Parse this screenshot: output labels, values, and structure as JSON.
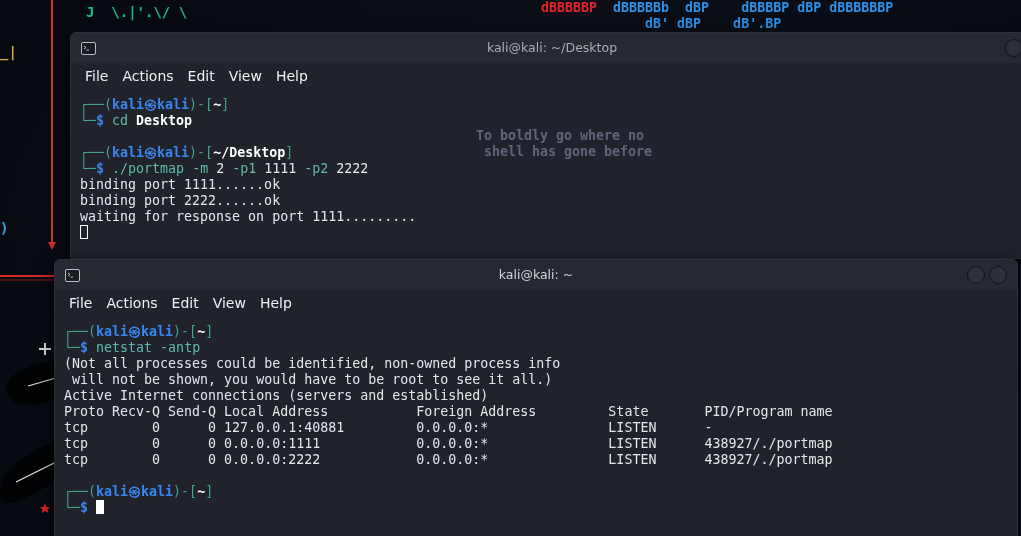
{
  "wallpaper": {
    "banner_lines": [
      [
        {
          "text": "dBBBBBP",
          "color": "#e5242b"
        },
        {
          "text": "  dBBBBBb  dBP    dBBBBP dBP dBBBBBBP",
          "color": "#2b90e6"
        }
      ],
      [
        {
          "text": "dB' dBP    dB'.BP",
          "color": "#2b90e6"
        }
      ]
    ],
    "art_fragments": [
      {
        "text": "J  \\.|'.\\/ \\",
        "color": "#18b894"
      },
      {
        "text": "_|",
        "color": "#d6a24a"
      },
      {
        "text": ")",
        "color": "#2aa8e0"
      }
    ],
    "motto": [
      "To boldly go where no",
      "shell has gone before"
    ]
  },
  "windows": [
    {
      "title": "kali@kali: ~/Desktop",
      "focused": false,
      "menu": [
        "File",
        "Actions",
        "Edit",
        "View",
        "Help"
      ],
      "lines": [
        {
          "kind": "prompt",
          "frame_top": "┌──(",
          "user": "kali",
          "at": "㉿",
          "host": "kali",
          "sep": ")-[",
          "cwd": "~",
          "close": "]",
          "frame_bottom": "└─",
          "symbol": "$",
          "tokens": [
            {
              "kind": "cmd",
              "text": "cd"
            },
            {
              "kind": "path",
              "text": "Desktop"
            }
          ]
        },
        {
          "kind": "blank"
        },
        {
          "kind": "prompt",
          "frame_top": "┌──(",
          "user": "kali",
          "at": "㉿",
          "host": "kali",
          "sep": ")-[",
          "cwd": "~/Desktop",
          "close": "]",
          "frame_bottom": "└─",
          "symbol": "$",
          "tokens": [
            {
              "kind": "cmd",
              "text": "./portmap"
            },
            {
              "kind": "opt",
              "text": "-m"
            },
            {
              "kind": "arg",
              "text": "2"
            },
            {
              "kind": "opt",
              "text": "-p1"
            },
            {
              "kind": "arg",
              "text": "1111"
            },
            {
              "kind": "opt",
              "text": "-p2"
            },
            {
              "kind": "arg",
              "text": "2222"
            }
          ]
        },
        {
          "kind": "output",
          "text": "binding port 1111......ok"
        },
        {
          "kind": "output",
          "text": "binding port 2222......ok"
        },
        {
          "kind": "output",
          "text": "waiting for response on port 1111........."
        },
        {
          "kind": "cursor"
        }
      ]
    },
    {
      "title": "kali@kali: ~",
      "focused": true,
      "menu": [
        "File",
        "Actions",
        "Edit",
        "View",
        "Help"
      ],
      "lines": [
        {
          "kind": "prompt",
          "frame_top": "┌──(",
          "user": "kali",
          "at": "㉿",
          "host": "kali",
          "sep": ")-[",
          "cwd": "~",
          "close": "]",
          "frame_bottom": "└─",
          "symbol": "$",
          "tokens": [
            {
              "kind": "cmd",
              "text": "netstat"
            },
            {
              "kind": "opt",
              "text": "-antp"
            }
          ]
        },
        {
          "kind": "output",
          "text": "(Not all processes could be identified, non-owned process info"
        },
        {
          "kind": "output",
          "text": " will not be shown, you would have to be root to see it all.)"
        },
        {
          "kind": "output",
          "text": "Active Internet connections (servers and established)"
        },
        {
          "kind": "output",
          "text": "Proto Recv-Q Send-Q Local Address           Foreign Address         State       PID/Program name"
        },
        {
          "kind": "output",
          "text": "tcp        0      0 127.0.0.1:40881         0.0.0.0:*               LISTEN      -"
        },
        {
          "kind": "output",
          "text": "tcp        0      0 0.0.0.0:1111            0.0.0.0:*               LISTEN      438927/./portmap"
        },
        {
          "kind": "output",
          "text": "tcp        0      0 0.0.0.0:2222            0.0.0.0:*               LISTEN      438927/./portmap"
        },
        {
          "kind": "blank"
        },
        {
          "kind": "prompt",
          "frame_top": "┌──(",
          "user": "kali",
          "at": "㉿",
          "host": "kali",
          "sep": ")-[",
          "cwd": "~",
          "close": "]",
          "frame_bottom": "└─",
          "symbol": "$",
          "cursor": true
        }
      ]
    }
  ]
}
